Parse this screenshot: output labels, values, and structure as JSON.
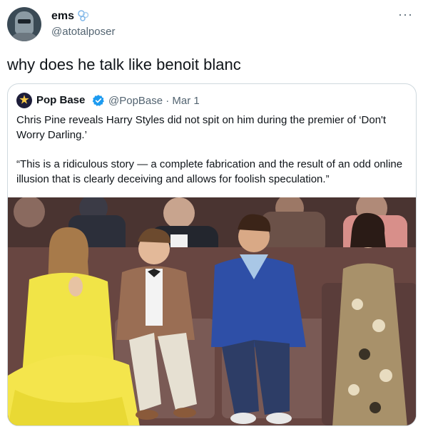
{
  "author": {
    "name": "ems",
    "handle": "@atotalposer"
  },
  "tweet": {
    "text": "why does he talk like benoit blanc"
  },
  "quoted": {
    "name": "Pop Base",
    "meta": "@PopBase · Mar 1",
    "paragraphs": [
      "Chris Pine reveals Harry Styles did not spit on him during the premier of ‘Don't Worry Darling.’",
      "“This is a ridiculous story — a complete fabrication and the result of an odd online illusion that is clearly deceiving and allows for foolish speculation.”"
    ]
  },
  "icons": {
    "avatar": "mandalorian-helmet-avatar",
    "verified": "blue-swirl-badge",
    "quote_verified": "blue-verified-check",
    "more": "more-dots-icon"
  },
  "colors": {
    "text": "#0f1419",
    "muted": "#536471",
    "border": "#cfd9de",
    "verified": "#1d9bf0"
  }
}
